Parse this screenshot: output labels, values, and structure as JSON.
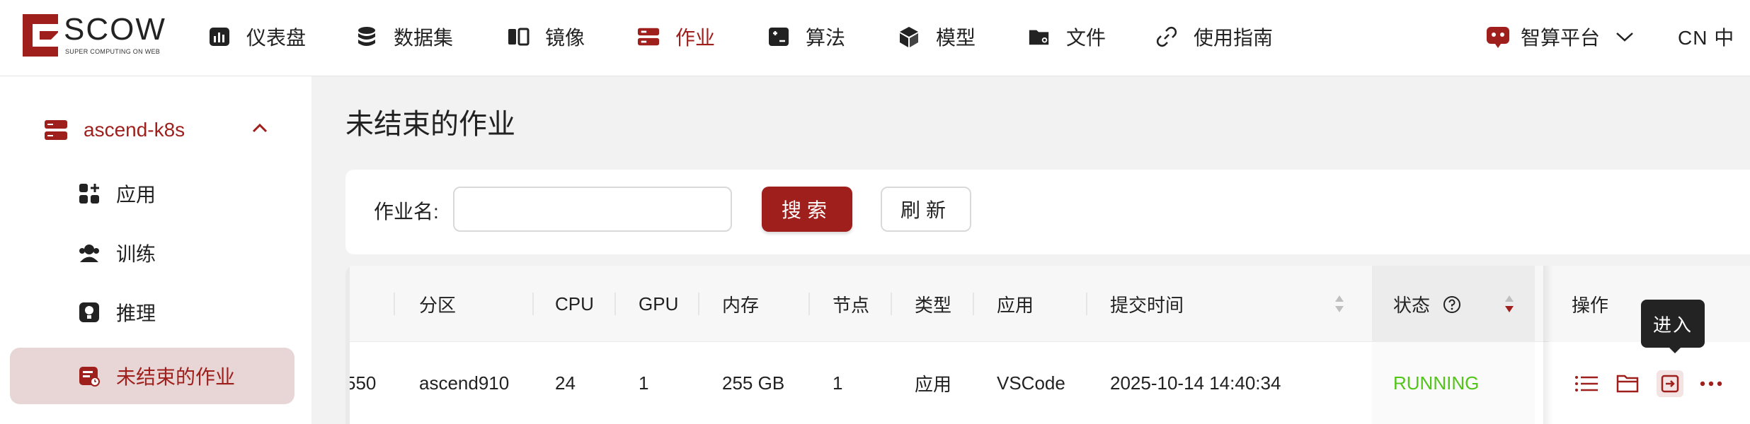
{
  "brand": {
    "title": "SCOW",
    "subtitle": "SUPER COMPUTING ON WEB",
    "accent": "#9e1f1b"
  },
  "nav": {
    "items": [
      {
        "label": "仪表盘",
        "icon": "dashboard-icon"
      },
      {
        "label": "数据集",
        "icon": "database-icon"
      },
      {
        "label": "镜像",
        "icon": "image-icon"
      },
      {
        "label": "作业",
        "icon": "server-icon",
        "active": true
      },
      {
        "label": "算法",
        "icon": "algorithm-icon"
      },
      {
        "label": "模型",
        "icon": "cube-icon"
      },
      {
        "label": "文件",
        "icon": "folder-icon"
      },
      {
        "label": "使用指南",
        "icon": "link-icon"
      }
    ],
    "platform": "智算平台",
    "language": "CN 中"
  },
  "sidebar": {
    "cluster": "ascend-k8s",
    "items": [
      {
        "label": "应用",
        "icon": "apps-icon"
      },
      {
        "label": "训练",
        "icon": "training-icon"
      },
      {
        "label": "推理",
        "icon": "inference-icon"
      },
      {
        "label": "未结束的作业",
        "icon": "running-jobs-icon",
        "active": true
      }
    ]
  },
  "main": {
    "title": "未结束的作业",
    "search": {
      "label": "作业名:",
      "value": "",
      "placeholder": "",
      "search_button": "搜索",
      "refresh_button": "刷新"
    },
    "table": {
      "headers": [
        "分区",
        "CPU",
        "GPU",
        "内存",
        "节点",
        "类型",
        "应用",
        "提交时间",
        "状态",
        "操作"
      ],
      "rows": [
        {
          "id_partial": "550",
          "partition": "ascend910",
          "cpu": "24",
          "gpu": "1",
          "memory": "255 GB",
          "nodes": "1",
          "type": "应用",
          "app": "VSCode",
          "submit_time": "2025-10-14 14:40:34",
          "status": "RUNNING"
        }
      ],
      "status_color": "#52c41a"
    },
    "tooltip": "进入"
  }
}
